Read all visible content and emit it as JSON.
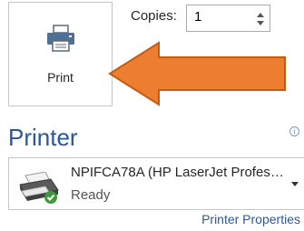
{
  "print_button": {
    "label": "Print",
    "icon": "printer-icon"
  },
  "copies": {
    "label": "Copies:",
    "value": "1"
  },
  "annotation": {
    "arrow_color": "#ed7d31",
    "arrow_outline": "#c55a11"
  },
  "printer": {
    "heading": "Printer",
    "info_icon": "info-icon",
    "selected": {
      "name": "NPIFCA78A (HP LaserJet Profes…",
      "status": "Ready",
      "icon": "printer-ready-icon"
    },
    "properties_link": "Printer Properties"
  },
  "colors": {
    "accent": "#2b579a",
    "text": "#262626",
    "border": "#c6c6c6",
    "ready_check": "#3c9a3c"
  }
}
